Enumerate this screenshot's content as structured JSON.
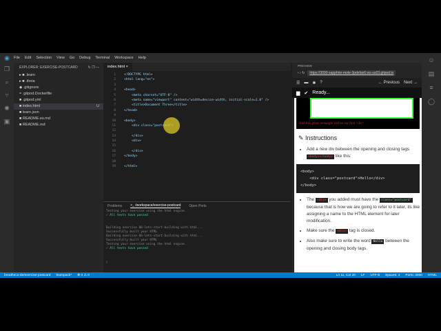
{
  "menu": [
    "File",
    "Edit",
    "Selection",
    "View",
    "Go",
    "Debug",
    "Terminal",
    "Workspace",
    "Help"
  ],
  "explorer": {
    "title": "EXPLORER: EXERCISE-POSTCARD",
    "items": [
      {
        "label": ".learn",
        "icon": "▸ ■",
        "badge": ""
      },
      {
        "label": ".theia",
        "icon": "▸ ■",
        "badge": ""
      },
      {
        "label": ".gitignore",
        "icon": "◆",
        "badge": ""
      },
      {
        "label": ".gitpod.Dockerfile",
        "icon": "=",
        "badge": ""
      },
      {
        "label": ".gitpod.yml",
        "icon": "■",
        "badge": ""
      },
      {
        "label": "index.html",
        "icon": "■",
        "badge": "U"
      },
      {
        "label": "learn.json",
        "icon": "■",
        "badge": ""
      },
      {
        "label": "README.es.md",
        "icon": "■",
        "badge": ""
      },
      {
        "label": "README.md",
        "icon": "■",
        "badge": ""
      }
    ]
  },
  "editor": {
    "tab": "index.html",
    "lines": [
      "<!DOCTYPE html>",
      "<html lang=\"en\">",
      "",
      "<head>",
      "    <meta charset=\"UTF-8\" />",
      "    <meta name=\"viewport\" content=\"width=device-width, initial-scale=1.0\" />",
      "    <title>Document Three</title>",
      "</head>",
      "",
      "<body>",
      "    <div class=\"postcard\">",
      "",
      "    </div>",
      "    <div>",
      "",
      "    </div>",
      "</body>",
      "",
      "</html>"
    ]
  },
  "terminal": {
    "tabs": [
      "Problems",
      ">_ /workspace/exercise-postcard",
      "Open Ports"
    ],
    "lines": [
      {
        "text": "Testing your exercise using the html engine.",
        "ok": false
      },
      {
        "text": "✓ All tests have passed",
        "ok": true
      },
      {
        "text": "",
        "ok": false
      },
      {
        "text": "",
        "ok": false
      },
      {
        "text": "Building exercise 06-lets-start-building with html...",
        "ok": false
      },
      {
        "text": "Successfully built your HTML",
        "ok": false
      },
      {
        "text": "Building exercise 06-lets-start-building with html...",
        "ok": false
      },
      {
        "text": "Successfully built your HTML",
        "ok": false
      },
      {
        "text": "Testing your exercise using the html engine.",
        "ok": false
      },
      {
        "text": "✓ All tests have passed",
        "ok": true
      }
    ]
  },
  "preview": {
    "title": "PREVIEW",
    "url": "https://3000-sapphire-mole-3pdefav6.ws-us03.gitpod.io",
    "prev": "← Previous",
    "next": "Next →",
    "ready": "Ready...",
    "caption": "And this green rectangle will be our first <div>",
    "heading": "Instructions",
    "b1a": "Add a new div between the opening and closing tags",
    "b1code": "<body></body>",
    "b1b": "like this:",
    "code1": "<body>",
    "code2": "    <div class=\"postcard\">Hello</div>",
    "code3": "</body>",
    "b2a": "The",
    "b2code": "<div>",
    "b2b": "you added must have the",
    "b2code2": "class=\"postcard\"",
    "b2c": "because that is how we are going to refer to it later, its like assigning a name to the HTML element for later modification.",
    "b3a": "Make sure the",
    "b3code": "<div>",
    "b3b": "tag is closed.",
    "b4a": "Also make sure to write the word",
    "b4code": "Hello",
    "b4b": "between the opening and closing body tags."
  },
  "status": {
    "repo": "breatheco-de/exercise-postcard",
    "branch": "learnpack*",
    "problems": "⊗ 0 ⚠ 0",
    "pos": "Ln 11, Col 20",
    "eol": "LF",
    "enc": "UTF-8",
    "spaces": "Spaces: 4",
    "ports": "Ports: 3000",
    "lang": "HTML"
  }
}
